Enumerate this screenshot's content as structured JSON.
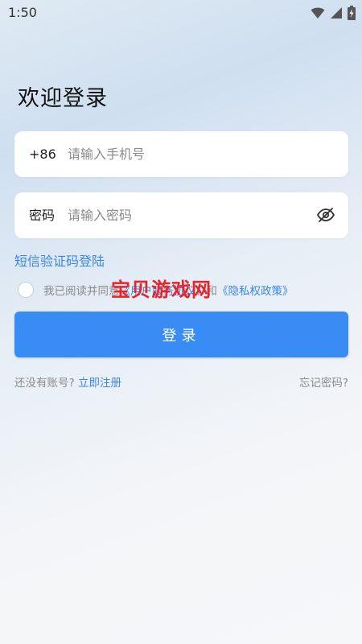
{
  "status_bar": {
    "time": "1:50",
    "icons": [
      "wifi-icon",
      "cellular-signal-icon",
      "battery-charging-icon"
    ]
  },
  "welcome": {
    "title": "欢迎登录"
  },
  "phone_field": {
    "prefix": "+86",
    "placeholder": "请输入手机号",
    "value": ""
  },
  "password_field": {
    "label": "密码",
    "placeholder": "请输入密码",
    "value": "",
    "toggle_icon": "eye-off-icon"
  },
  "sms_login": {
    "label": "短信验证码登陆"
  },
  "agreement": {
    "prefix": "我已阅读并同意",
    "user_agreement": "《用户服务协议》",
    "conjunction": "和",
    "privacy_policy": "《隐私权政策》"
  },
  "watermark": {
    "text": "宝贝游戏网"
  },
  "login_button": {
    "label": "登录"
  },
  "footer": {
    "no_account": "还没有账号?",
    "register": "立即注册",
    "forgot_password": "忘记密码?"
  },
  "colors": {
    "accent": "#3a8cf5",
    "link": "#3a86e6",
    "watermark": "#e8232a"
  }
}
